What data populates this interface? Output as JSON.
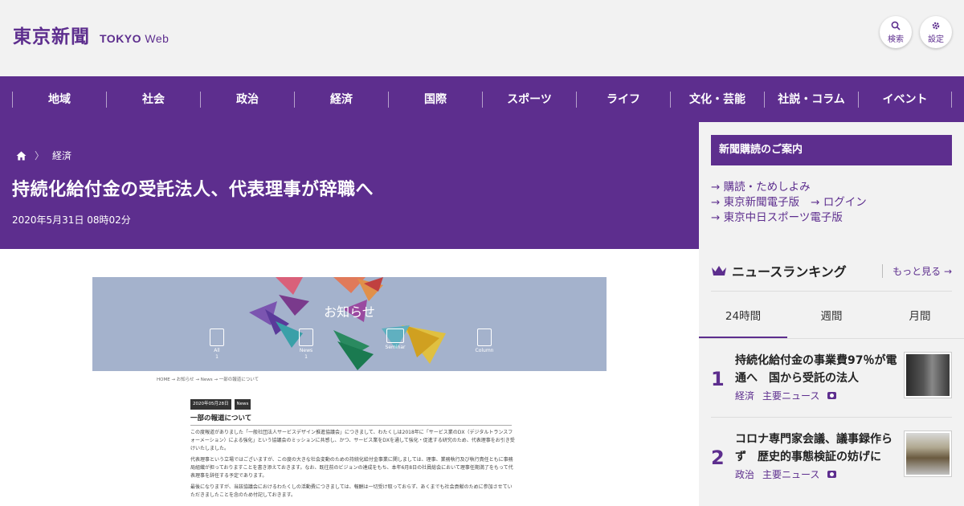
{
  "header": {
    "logo_jp": "東京新聞",
    "logo_en_bold": "TOKYO",
    "logo_en_light": "Web",
    "search_label": "検索",
    "settings_label": "設定"
  },
  "nav": {
    "items": [
      "地域",
      "社会",
      "政治",
      "経済",
      "国際",
      "スポーツ",
      "ライフ",
      "文化・芸能",
      "社説・コラム",
      "イベント"
    ]
  },
  "article": {
    "breadcrumb_home_icon": "home-icon",
    "breadcrumb_section": "経済",
    "title": "持続化給付金の受託法人、代表理事が辞職へ",
    "date": "2020年5月31日 08時02分",
    "image": {
      "banner_title": "お知らせ",
      "icons": [
        {
          "label": "All",
          "count": "1"
        },
        {
          "label": "News",
          "count": "1"
        },
        {
          "label": "Seminar",
          "count": ""
        },
        {
          "label": "Column",
          "count": ""
        }
      ],
      "path": "HOME → お知らせ → News → 一部の報道について",
      "date_tag": "2020年05月28日",
      "category_tag": "News",
      "heading": "一部の報道について",
      "paragraphs": [
        "この度報道がありました「一般社団法人サービスデザイン推進協議会」につきまして、わたくしは2018年に「サービス業のDX（デジタルトランスフォーメーション）による強化」という協議会のミッションに共感し、かつ、サービス業をDXを通して強化・促進する研究のため、代表理事をお引き受けいたしました。",
        "代表理事という立場ではございますが、この度の大きな社会変動のための持続化給付金事業に関しましては、理事、業務執行及び執行責任ともに事務局組織が担っておりますことを書き添えておきます。なお、既往前のビジョンの達成をもち、本年6月8日の社員総会において理事任期満了をもって代表理事を辞任する予定であります。",
        "最後になりますが、当該協議会におけるわたくしの活動費につきましては、報酬は一切受け取っておらず、あくまでも社会貢献のために参加させていただきましたことを念のため付記しておきます。"
      ]
    }
  },
  "sidebar": {
    "subscribe_heading": "新聞購読のご案内",
    "links": {
      "trial": "→ 購読・ためしよみ",
      "digital": "→ 東京新聞電子版",
      "login": "→ ログイン",
      "sports": "→ 東京中日スポーツ電子版"
    },
    "ranking": {
      "title": "ニュースランキング",
      "more": "もっと見る →",
      "tabs": [
        "24時間",
        "週間",
        "月間"
      ],
      "items": [
        {
          "rank": "1",
          "title": "持続化給付金の事業費97％が電通へ　国から受託の法人",
          "tag1": "経済",
          "tag2": "主要ニュース"
        },
        {
          "rank": "2",
          "title": "コロナ専門家会議、議事録作らず　歴史的事態検証の妨げに",
          "tag1": "政治",
          "tag2": "主要ニュース"
        }
      ]
    }
  },
  "colors": {
    "brand_purple": "#5d2e8e",
    "background": "#f2f2f2"
  }
}
